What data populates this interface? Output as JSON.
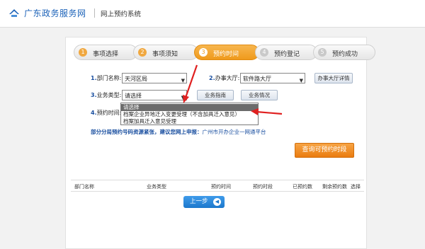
{
  "header": {
    "brand": "广东政务服务网",
    "system": "网上预约系统"
  },
  "steps": [
    {
      "num": "1",
      "label": "事项选择"
    },
    {
      "num": "2",
      "label": "事项须知"
    },
    {
      "num": "3",
      "label": "预约时间"
    },
    {
      "num": "4",
      "label": "预约登记"
    },
    {
      "num": "5",
      "label": "预约成功"
    }
  ],
  "active_step": 3,
  "form": {
    "dept_label_num": "1.",
    "dept_label": "部门名称:",
    "dept_value": "天河区局",
    "hall_label_num": "2.",
    "hall_label": "办事大厅:",
    "hall_value": "软件路大厅",
    "hall_detail_btn": "办事大厅详情",
    "biz_label_num": "3.",
    "biz_label": "业务类型:",
    "biz_value": "请选择",
    "biz_guide_btn": "业务指南",
    "biz_status_btn": "业务情况",
    "time_label_num": "4.",
    "time_label": "预约时间:"
  },
  "dropdown": {
    "options": [
      "请选择",
      "档案企业异地迁入变更受理（不含加具迁入意见）",
      "档案加具迁入意见受理"
    ],
    "highlighted": 0
  },
  "notice": {
    "text": "部分分局预约号码资源紧张，建议您网上申报：",
    "link": "广州市开办企业一网通平台"
  },
  "query_button": "查询可预约时段",
  "table": {
    "headers": [
      "部门名称",
      "业务类型",
      "预约时间",
      "预约时段",
      "已预约数",
      "剩余预约数",
      "选择"
    ]
  },
  "prev_button": "上一步",
  "colors": {
    "accent_orange": "#ef9a1c",
    "link_blue": "#1a4fa0",
    "button_blue": "#1c78cc",
    "annotation_red": "#e02020"
  }
}
